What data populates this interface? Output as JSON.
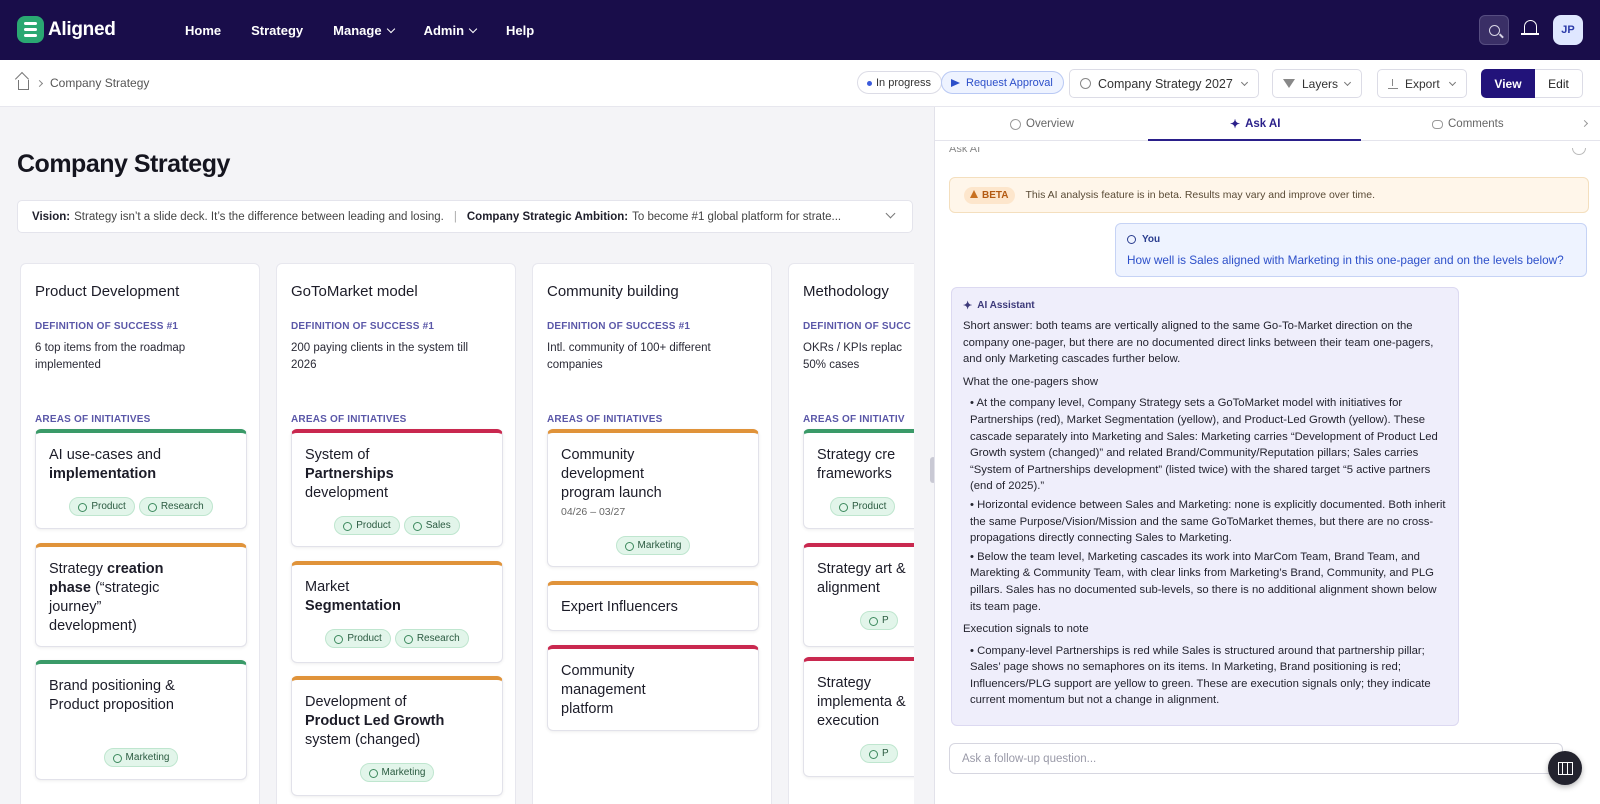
{
  "app": {
    "name": "Aligned"
  },
  "nav": {
    "home": "Home",
    "strategy": "Strategy",
    "manage": "Manage",
    "admin": "Admin",
    "help": "Help",
    "avatar": "JP"
  },
  "breadcrumb": {
    "current": "Company Strategy"
  },
  "toolbar": {
    "status": "In progress",
    "request_approval": "Request Approval",
    "version": "Company Strategy 2027",
    "layers": "Layers",
    "export": "Export",
    "view": "View",
    "edit": "Edit"
  },
  "page": {
    "title": "Company Strategy",
    "vision_label": "Vision:",
    "vision_text": "Strategy isn’t a slide deck. It’s the difference between leading and losing.",
    "separator": "|",
    "ambition_label": "Company Strategic Ambition:",
    "ambition_text": "To become #1 global platform for strate..."
  },
  "columns": [
    {
      "title": "Product Development",
      "dos_label": "DEFINITION OF SUCCESS #1",
      "dos_text": "6 top items from the roadmap implemented",
      "aoi_label": "AREAS OF INITIATIVES",
      "cards": [
        {
          "pre": "AI use-cases and ",
          "bold": "implementation",
          "post": "",
          "date": "",
          "tags": [
            "Product",
            "Research"
          ],
          "color": "#3a9a68"
        },
        {
          "pre": "Strategy ",
          "bold": "creation phase",
          "post": " (“strategic journey” development)",
          "date": "",
          "tags": [],
          "color": "#e0933a"
        },
        {
          "pre": "Brand positioning & Product proposition",
          "bold": "",
          "post": "",
          "date": "",
          "tags": [
            "Marketing"
          ],
          "color": "#3a9a68"
        }
      ]
    },
    {
      "title": "GoToMarket model",
      "dos_label": "DEFINITION OF SUCCESS #1",
      "dos_text": "200 paying clients in the system till 2026",
      "aoi_label": "AREAS OF INITIATIVES",
      "cards": [
        {
          "pre": "System of ",
          "bold": "Partnerships",
          "post": " development",
          "date": "",
          "tags": [
            "Product",
            "Sales"
          ],
          "color": "#c9284f"
        },
        {
          "pre": "Market ",
          "bold": "Segmentation",
          "post": "",
          "date": "",
          "tags": [
            "Product",
            "Research"
          ],
          "color": "#e0933a"
        },
        {
          "pre": "Development of ",
          "bold": "Product Led Growth",
          "post": " system (changed)",
          "date": "",
          "tags": [
            "Marketing"
          ],
          "color": "#e0933a"
        }
      ]
    },
    {
      "title": "Community building",
      "dos_label": "DEFINITION OF SUCCESS #1",
      "dos_text": "Intl. community of 100+ different companies",
      "aoi_label": "AREAS OF INITIATIVES",
      "cards": [
        {
          "pre": "Community development program launch",
          "bold": "",
          "post": "",
          "date": "04/26 – 03/27",
          "tags": [
            "Marketing"
          ],
          "color": "#e0933a"
        },
        {
          "pre": "Expert Influencers",
          "bold": "",
          "post": "",
          "date": "",
          "tags": [],
          "color": "#e0933a"
        },
        {
          "pre": "Community management platform",
          "bold": "",
          "post": "",
          "date": "",
          "tags": [],
          "color": "#c9284f"
        }
      ]
    },
    {
      "title": "Methodology",
      "dos_label": "DEFINITION OF SUCC",
      "dos_text": "OKRs / KPIs replac 50% cases",
      "aoi_label": "AREAS OF INITIATIV",
      "cards": [
        {
          "pre": "Strategy cre frameworks",
          "bold": "",
          "post": "",
          "date": "",
          "tags": [
            "Product"
          ],
          "color": "#3a9a68"
        },
        {
          "pre": "Strategy art & alignment",
          "bold": "",
          "post": "",
          "date": "",
          "tags": [
            "P"
          ],
          "color": "#c9284f"
        },
        {
          "pre": "Strategy implementa & execution",
          "bold": "",
          "post": "",
          "date": "",
          "tags": [
            "P"
          ],
          "color": "#c9284f"
        }
      ]
    }
  ],
  "panel": {
    "tabs": {
      "overview": "Overview",
      "ask_ai": "Ask AI",
      "comments": "Comments"
    },
    "cut_text": "Ask AI",
    "beta_tag": "BETA",
    "beta_text": "This AI analysis feature is in beta. Results may vary and improve over time.",
    "you_label": "You",
    "question": "How well is Sales aligned with Marketing in this one-pager and on the levels below?",
    "ai_label": "AI Assistant",
    "ai_short": "Short answer: both teams are vertically aligned to the same Go-To-Market direction on the company one-pager, but there are no documented direct links between their team one-pagers, and only Marketing cascades further below.",
    "ai_head1": "What the one-pagers show",
    "ai_b1": "• At the company level, Company Strategy sets a GoToMarket model with initiatives for Partnerships (red), Market Segmentation (yellow), and Product-Led Growth (yellow). These cascade separately into Marketing and Sales: Marketing carries “Development of Product Led Growth system (changed)” and related Brand/Community/Reputation pillars; Sales carries “System of Partnerships development” (listed twice) with the shared target “5 active partners (end of 2025).”",
    "ai_b2": "• Horizontal evidence between Sales and Marketing: none is explicitly documented. Both inherit the same Purpose/Vision/Mission and the same GoToMarket themes, but there are no cross-propagations directly connecting Sales to Marketing.",
    "ai_b3": "• Below the team level, Marketing cascades its work into MarCom Team, Brand Team, and Marekting & Community Team, with clear links from Marketing’s Brand, Community, and PLG pillars. Sales has no documented sub-levels, so there is no additional alignment shown below its team page.",
    "ai_head2": "Execution signals to note",
    "ai_b4": "• Company-level Partnerships is red while Sales is structured around that partnership pillar; Sales’ page shows no semaphores on its items. In Marketing, Brand positioning is red; Influencers/PLG support are yellow to green. These are execution signals only; they indicate current momentum but not a change in alignment.",
    "followup_placeholder": "Ask a follow-up question..."
  }
}
